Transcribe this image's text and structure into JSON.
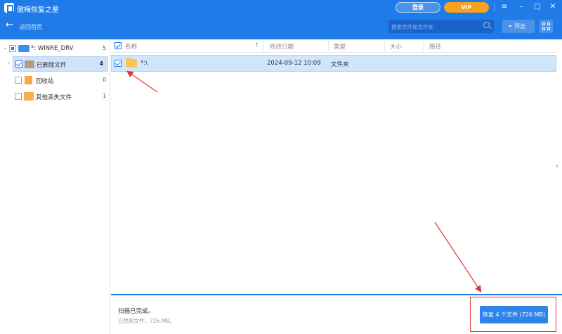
{
  "app": {
    "title": "傲梅恢复之星",
    "login": "登录",
    "vip": "VIP"
  },
  "toolbar": {
    "back_label": "返回首页",
    "search_placeholder": "搜索文件和文件夹",
    "filter_label": "筛选"
  },
  "sidebar": {
    "drive": {
      "label": "*: WINRE_DRV",
      "count": "5"
    },
    "items": [
      {
        "label": "已删除文件",
        "count": "4",
        "checked": true
      },
      {
        "label": "回收站",
        "count": "0",
        "checked": false
      },
      {
        "label": "其他丢失文件",
        "count": "1",
        "checked": false
      }
    ]
  },
  "table": {
    "headers": [
      "名称",
      "修改日期",
      "类型",
      "大小",
      "路径"
    ],
    "rows": [
      {
        "name": "*:\\",
        "modified": "2024-09-12 10:09",
        "type": "文件夹",
        "size": "",
        "path": "",
        "checked": true
      }
    ]
  },
  "status": {
    "title": "扫描已完成。",
    "found": "已找到文件：726 MB。",
    "recover_button": "恢复 4 个文件 (726 MB)"
  },
  "colors": {
    "primary": "#1f7be8",
    "vip": "#f7a21d",
    "annotation": "#e5333a"
  }
}
